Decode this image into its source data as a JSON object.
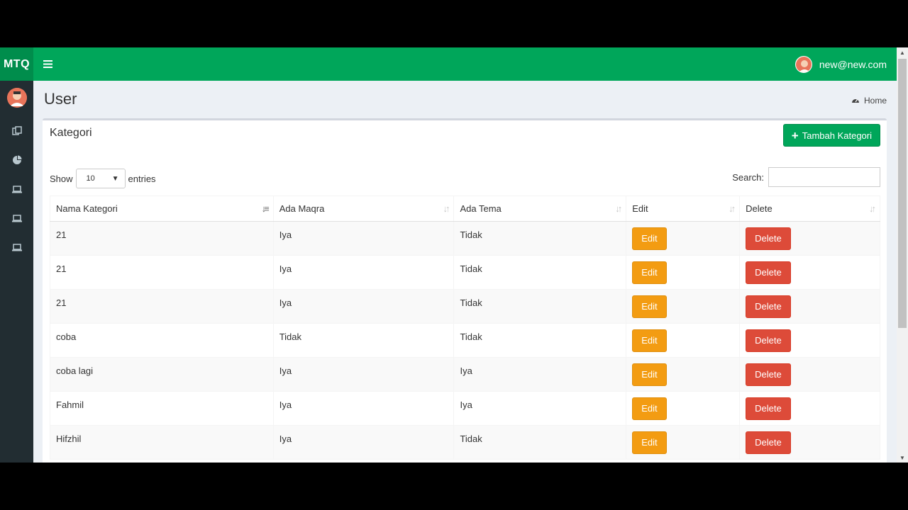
{
  "brand": "MTQ",
  "user": {
    "email": "new@new.com"
  },
  "sidebar": {
    "items": [
      {
        "icon": "copy-icon"
      },
      {
        "icon": "pie-chart-icon"
      },
      {
        "icon": "laptop-icon"
      },
      {
        "icon": "laptop-icon"
      },
      {
        "icon": "laptop-icon"
      }
    ]
  },
  "header": {
    "title": "User",
    "breadcrumb": "Home"
  },
  "box": {
    "title": "Kategori",
    "add_button": "Tambah Kategori"
  },
  "length": {
    "show": "Show",
    "value": "10",
    "entries": "entries"
  },
  "search": {
    "label": "Search:"
  },
  "table": {
    "columns": [
      "Nama Kategori",
      "Ada Maqra",
      "Ada Tema",
      "Edit",
      "Delete"
    ],
    "rows": [
      {
        "nama": "21",
        "maqra": "Iya",
        "tema": "Tidak",
        "edit": "Edit",
        "delete": "Delete"
      },
      {
        "nama": "21",
        "maqra": "Iya",
        "tema": "Tidak",
        "edit": "Edit",
        "delete": "Delete"
      },
      {
        "nama": "21",
        "maqra": "Iya",
        "tema": "Tidak",
        "edit": "Edit",
        "delete": "Delete"
      },
      {
        "nama": "coba",
        "maqra": "Tidak",
        "tema": "Tidak",
        "edit": "Edit",
        "delete": "Delete"
      },
      {
        "nama": "coba lagi",
        "maqra": "Iya",
        "tema": "Iya",
        "edit": "Edit",
        "delete": "Delete"
      },
      {
        "nama": "Fahmil",
        "maqra": "Iya",
        "tema": "Iya",
        "edit": "Edit",
        "delete": "Delete"
      },
      {
        "nama": "Hifzhil",
        "maqra": "Iya",
        "tema": "Tidak",
        "edit": "Edit",
        "delete": "Delete"
      }
    ]
  },
  "colors": {
    "primary": "#00a65a",
    "sidebar": "#222d32",
    "warning": "#f39c12",
    "danger": "#dd4b39"
  }
}
